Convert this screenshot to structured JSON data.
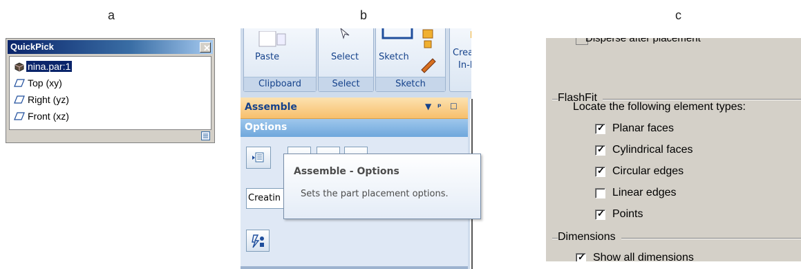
{
  "panel_labels": {
    "a": "a",
    "b": "b",
    "c": "c"
  },
  "quickpick": {
    "title": "QuickPick",
    "close_glyph": "✕",
    "items": [
      {
        "label": "nina.par:1",
        "icon": "part-icon",
        "selected": true
      },
      {
        "label": "Top (xy)",
        "icon": "plane-icon",
        "selected": false
      },
      {
        "label": "Right (yz)",
        "icon": "plane-icon",
        "selected": false
      },
      {
        "label": "Front (xz)",
        "icon": "plane-icon",
        "selected": false
      }
    ]
  },
  "ribbon": {
    "groups": [
      {
        "caption": "Clipboard",
        "buttons": [
          "Paste"
        ]
      },
      {
        "caption": "Select",
        "buttons": [
          "Select"
        ]
      },
      {
        "caption": "Sketch",
        "buttons": [
          "Sketch"
        ]
      },
      {
        "caption": "",
        "buttons": [
          "Create",
          "In-Pla"
        ]
      }
    ]
  },
  "assemble": {
    "title": "Assemble",
    "controls": [
      "▼",
      "ᵖ",
      "☐"
    ],
    "options_title": "Options",
    "options_chevron": "⌃",
    "creating_value": "Creatin"
  },
  "tooltip": {
    "title": "Assemble - Options",
    "body": "Sets the part placement options."
  },
  "flashfit_panel": {
    "cut_top_text": "Disperse after placement",
    "group_title": "FlashFit",
    "locate_label": "Locate the following element types:",
    "checkboxes": [
      {
        "label": "Planar faces",
        "checked": true
      },
      {
        "label": "Cylindrical faces",
        "checked": true
      },
      {
        "label": "Circular edges",
        "checked": true
      },
      {
        "label": "Linear edges",
        "checked": false
      },
      {
        "label": "Points",
        "checked": true
      }
    ],
    "dimensions_title": "Dimensions",
    "cut_bottom_text": "Show all dimensions"
  }
}
